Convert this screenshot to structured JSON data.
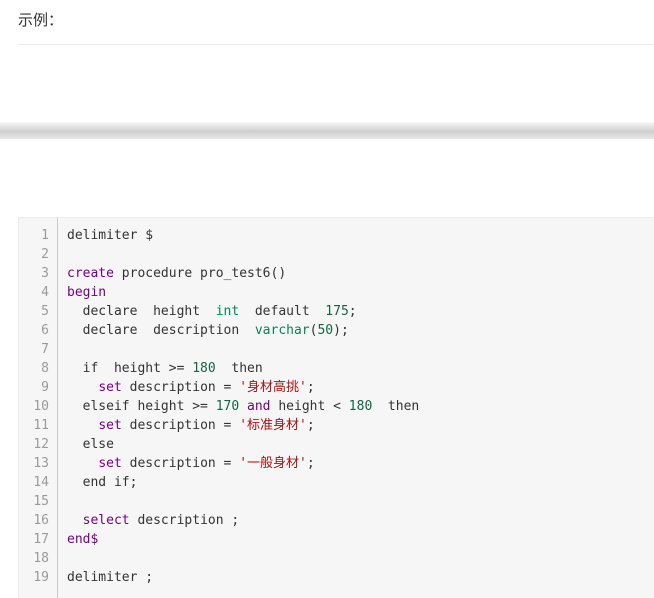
{
  "header": {
    "label": "示例："
  },
  "code": {
    "lines": [
      {
        "n": "1",
        "tokens": [
          {
            "t": "delimiter $",
            "c": "plain"
          }
        ]
      },
      {
        "n": "2",
        "tokens": []
      },
      {
        "n": "3",
        "tokens": [
          {
            "t": "create",
            "c": "kw"
          },
          {
            "t": " procedure pro_test6()",
            "c": "plain"
          }
        ]
      },
      {
        "n": "4",
        "tokens": [
          {
            "t": "begin",
            "c": "kw"
          }
        ]
      },
      {
        "n": "5",
        "tokens": [
          {
            "t": "  declare  height  ",
            "c": "plain"
          },
          {
            "t": "int",
            "c": "type"
          },
          {
            "t": "  default  ",
            "c": "plain"
          },
          {
            "t": "175",
            "c": "num"
          },
          {
            "t": ";",
            "c": "plain"
          }
        ]
      },
      {
        "n": "6",
        "tokens": [
          {
            "t": "  declare  description  ",
            "c": "plain"
          },
          {
            "t": "varchar",
            "c": "type"
          },
          {
            "t": "(",
            "c": "plain"
          },
          {
            "t": "50",
            "c": "num"
          },
          {
            "t": ");",
            "c": "plain"
          }
        ]
      },
      {
        "n": "7",
        "tokens": []
      },
      {
        "n": "8",
        "tokens": [
          {
            "t": "  if  height >= ",
            "c": "plain"
          },
          {
            "t": "180",
            "c": "num"
          },
          {
            "t": "  then",
            "c": "plain"
          }
        ]
      },
      {
        "n": "9",
        "tokens": [
          {
            "t": "    ",
            "c": "plain"
          },
          {
            "t": "set",
            "c": "kw"
          },
          {
            "t": " description = ",
            "c": "plain"
          },
          {
            "t": "'身材高挑'",
            "c": "str"
          },
          {
            "t": ";",
            "c": "plain"
          }
        ]
      },
      {
        "n": "10",
        "tokens": [
          {
            "t": "  elseif height >= ",
            "c": "plain"
          },
          {
            "t": "170",
            "c": "num"
          },
          {
            "t": " ",
            "c": "plain"
          },
          {
            "t": "and",
            "c": "kw"
          },
          {
            "t": " height < ",
            "c": "plain"
          },
          {
            "t": "180",
            "c": "num"
          },
          {
            "t": "  then",
            "c": "plain"
          }
        ]
      },
      {
        "n": "11",
        "tokens": [
          {
            "t": "    ",
            "c": "plain"
          },
          {
            "t": "set",
            "c": "kw"
          },
          {
            "t": " description = ",
            "c": "plain"
          },
          {
            "t": "'标准身材'",
            "c": "str"
          },
          {
            "t": ";",
            "c": "plain"
          }
        ]
      },
      {
        "n": "12",
        "tokens": [
          {
            "t": "  else",
            "c": "plain"
          }
        ]
      },
      {
        "n": "13",
        "tokens": [
          {
            "t": "    ",
            "c": "plain"
          },
          {
            "t": "set",
            "c": "kw"
          },
          {
            "t": " description = ",
            "c": "plain"
          },
          {
            "t": "'一般身材'",
            "c": "str"
          },
          {
            "t": ";",
            "c": "plain"
          }
        ]
      },
      {
        "n": "14",
        "tokens": [
          {
            "t": "  end if;",
            "c": "plain"
          }
        ]
      },
      {
        "n": "15",
        "tokens": []
      },
      {
        "n": "16",
        "tokens": [
          {
            "t": "  ",
            "c": "plain"
          },
          {
            "t": "select",
            "c": "kw"
          },
          {
            "t": " description ;",
            "c": "plain"
          }
        ]
      },
      {
        "n": "17",
        "tokens": [
          {
            "t": "end$",
            "c": "kw"
          }
        ]
      },
      {
        "n": "18",
        "tokens": []
      },
      {
        "n": "19",
        "tokens": [
          {
            "t": "delimiter ;",
            "c": "plain"
          }
        ]
      }
    ]
  },
  "colors": {
    "keyword": "#770088",
    "type": "#008855",
    "number": "#116644",
    "string": "#aa1111"
  }
}
